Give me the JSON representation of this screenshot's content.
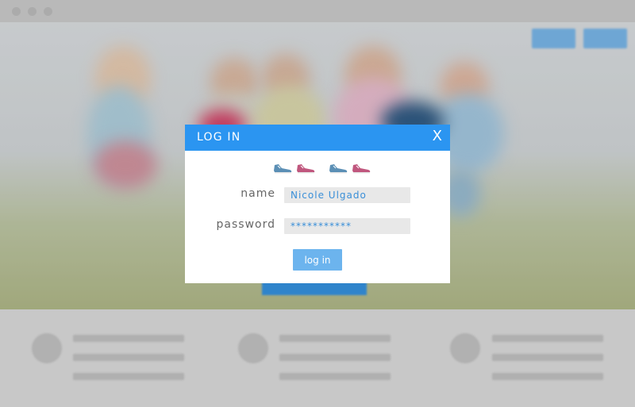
{
  "modal": {
    "title": "LOG IN",
    "close_label": "X",
    "name_label": "name",
    "name_value": "Nicole Ulgado",
    "password_label": "password",
    "password_value": "***********",
    "login_button": "log in"
  },
  "colors": {
    "header": "#2b95f1",
    "button": "#6cb4ee",
    "shoe_blue": "#5b8fb5",
    "shoe_pink": "#c0577e"
  },
  "icons": [
    "blue-shoe-icon",
    "pink-shoe-icon",
    "blue-shoe-icon",
    "pink-shoe-icon"
  ]
}
